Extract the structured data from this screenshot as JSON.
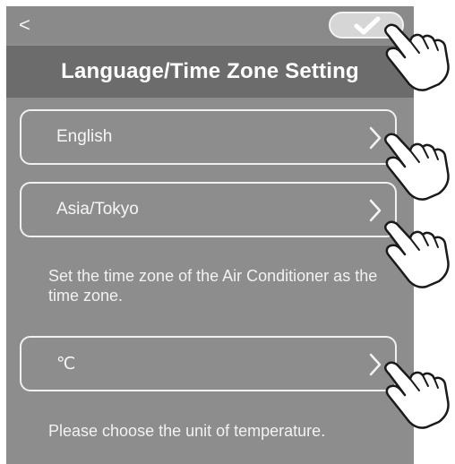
{
  "header": {
    "back_glyph": "<",
    "title": "Language/Time Zone Setting",
    "back_icon": "back-chevron-icon",
    "confirm_icon": "checkmark-icon"
  },
  "settings": {
    "language": {
      "value": "English"
    },
    "time_zone": {
      "value": "Asia/Tokyo"
    },
    "time_zone_note": "Set the time zone of the Air Conditioner as the time zone.",
    "temperature_unit": {
      "value": "℃"
    },
    "temperature_note": "Please choose the unit of temperature."
  },
  "icons": {
    "row_chevron": "chevron-right-icon",
    "pointer": "tapping-hand-icon"
  },
  "colors": {
    "screen_bg": "#8d8d8d",
    "title_bar": "#6c6c6c",
    "text": "#ffffff"
  }
}
